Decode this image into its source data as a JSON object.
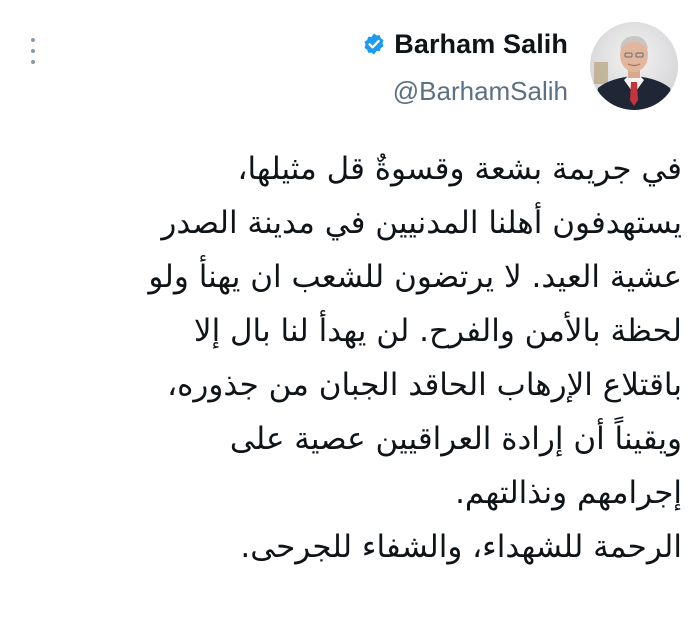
{
  "tweet": {
    "author": {
      "display_name": "Barham Salih",
      "handle": "@BarhamSalih",
      "verified": true
    },
    "text_lines": [
      "في جريمة بشعة وقسوةٌ قل مثيلها،",
      "يستهدفون أهلنا المدنيين في مدينة الصدر",
      "عشية العيد. لا يرتضون للشعب ان يهنأ ولو",
      "لحظة بالأمن والفرح. لن يهدأ لنا بال إلا",
      "باقتلاع الإرهاب الحاقد الجبان من جذوره،",
      "ويقيناً أن إرادة العراقيين عصية على",
      "إجرامهم ونذالتهم.",
      "الرحمة للشهداء، والشفاء للجرحى."
    ]
  },
  "icons": {
    "more": "more-vertical-icon",
    "verified": "verified-badge-icon"
  },
  "colors": {
    "verified_blue": "#1d9bf0",
    "text": "#0f1419",
    "secondary": "#5b7083"
  }
}
